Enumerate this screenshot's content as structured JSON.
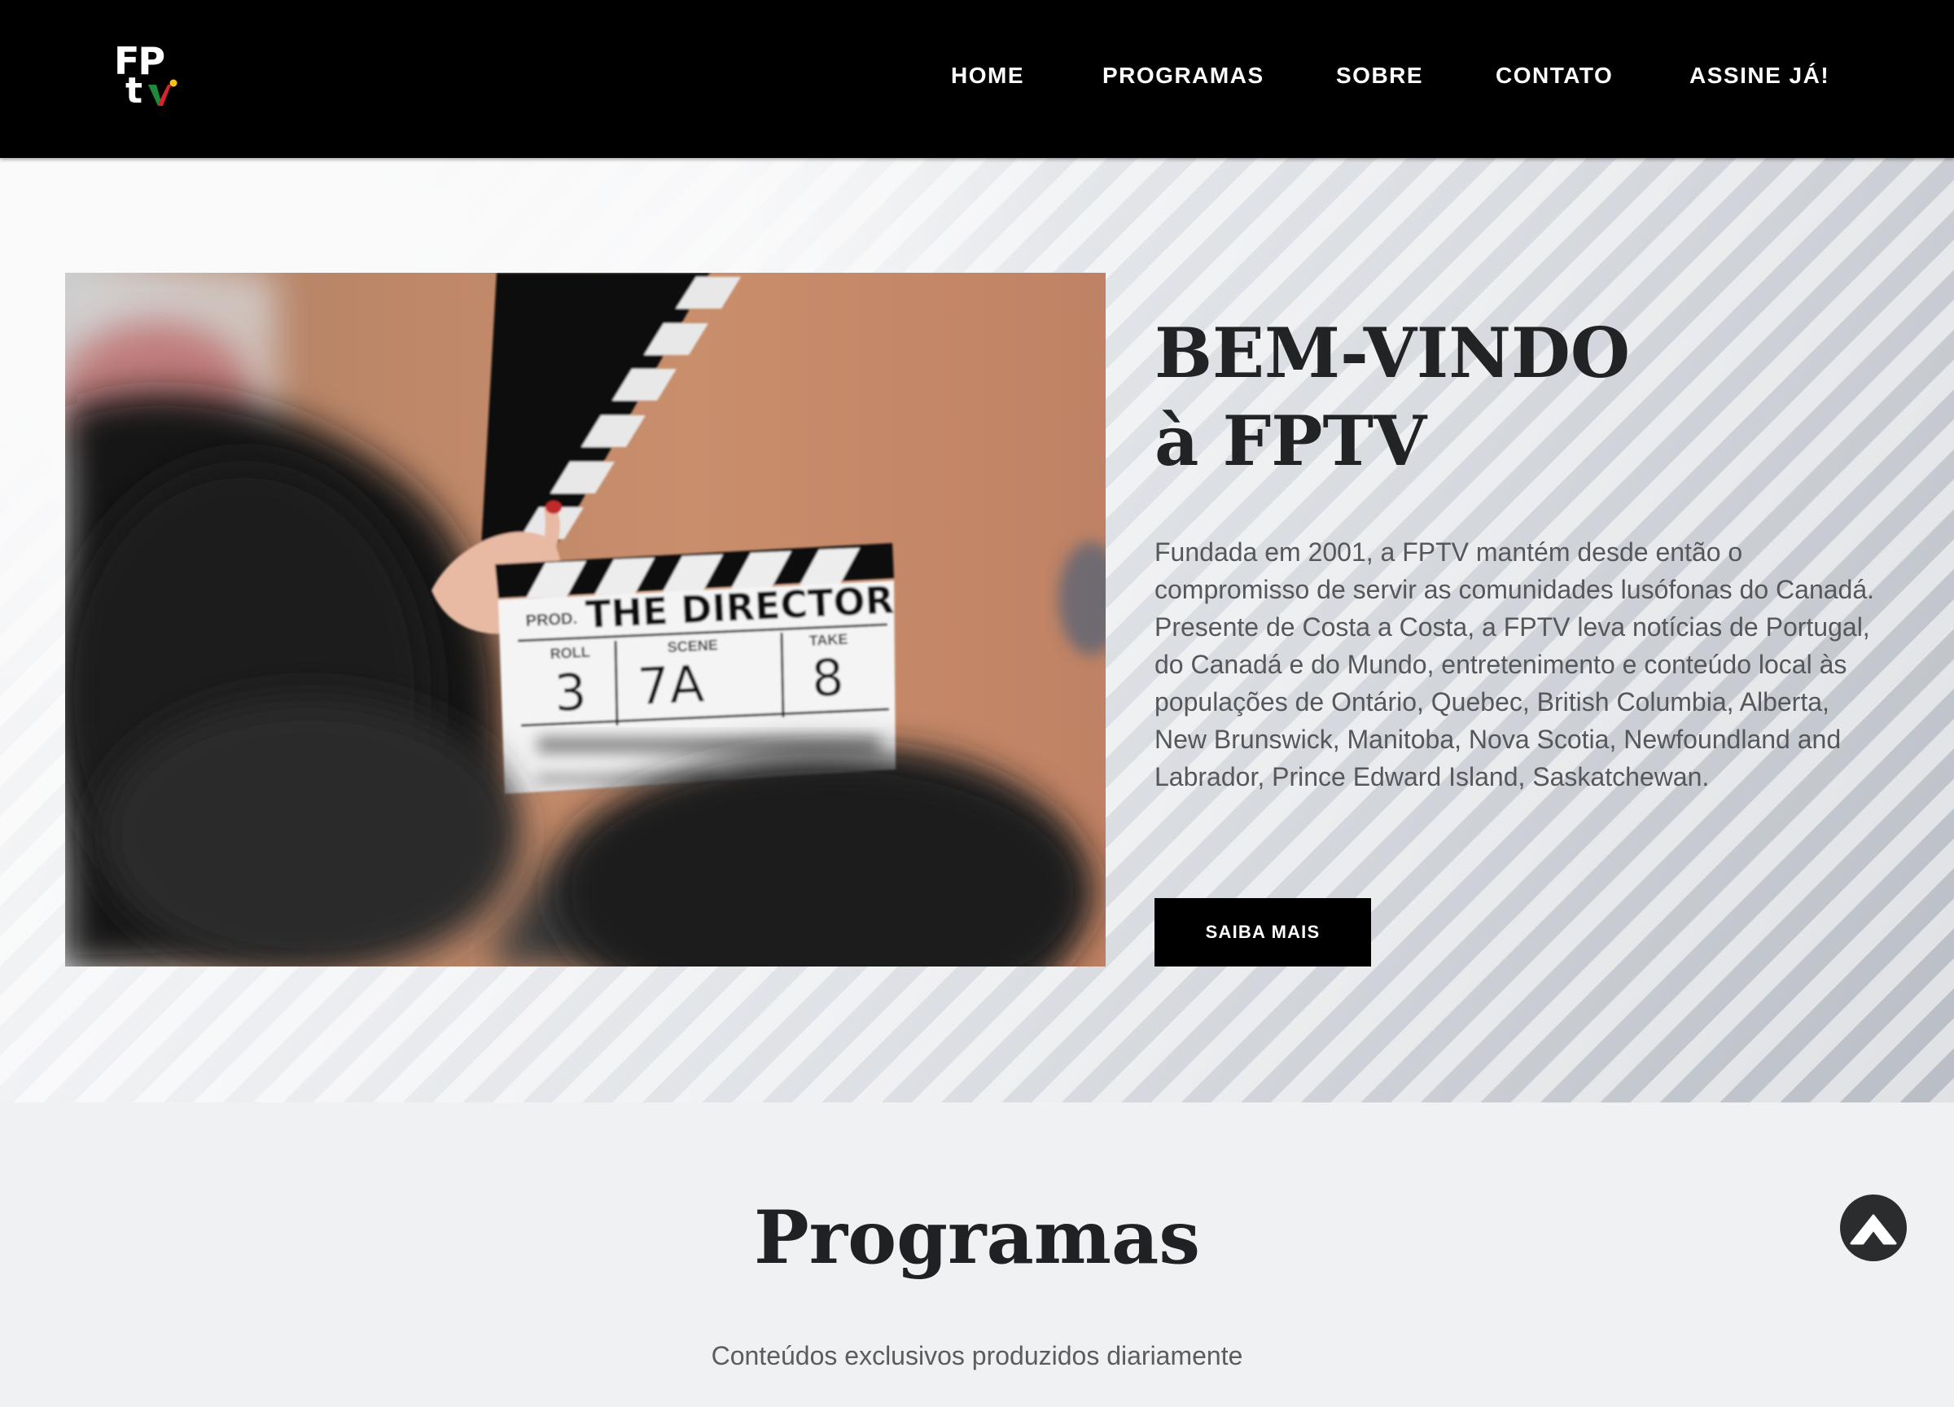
{
  "header": {
    "logo_text_top": "FP",
    "logo_text_bottom": "t",
    "nav": [
      {
        "label": "HOME"
      },
      {
        "label": "PROGRAMAS"
      },
      {
        "label": "SOBRE"
      },
      {
        "label": "CONTATO"
      },
      {
        "label": "ASSINE JÁ!"
      }
    ]
  },
  "hero": {
    "title": "BEM-VINDO\nà FPTV",
    "paragraph_1": "Fundada em 2001, a FPTV mantém desde então o compromisso de servir as comunidades lusófonas do Canadá.",
    "paragraph_2": "Presente de Costa a Costa, a FPTV leva notícias de Portugal, do Canadá e do Mundo, entretenimento e conteúdo local às populações de Ontário, Quebec, British Columbia, Alberta, New Brunswick, Manitoba, Nova Scotia, Newfoundland and Labrador, Prince Edward Island, Saskatchewan.",
    "cta_label": "SAIBA MAIS",
    "image": {
      "slate_prod_label": "PROD.",
      "slate_title": "THE DIRECTOR",
      "slate_roll_label": "ROLL",
      "slate_scene_label": "SCENE",
      "slate_take_label": "TAKE",
      "slate_roll": "3",
      "slate_scene": "7A",
      "slate_take": "8"
    }
  },
  "programas": {
    "title": "Programas",
    "subtitle": "Conteúdos exclusivos produzidos diariamente"
  },
  "colors": {
    "header_bg": "#000000",
    "nav_text": "#ffffff",
    "cta_bg": "#000000",
    "title_text": "#222325",
    "body_text": "#55575b",
    "logo_green": "#1e8a3c",
    "logo_red": "#d6262b",
    "logo_yellow": "#f2c21b"
  },
  "icons": {
    "back_to_top": "chevron-up-icon"
  }
}
